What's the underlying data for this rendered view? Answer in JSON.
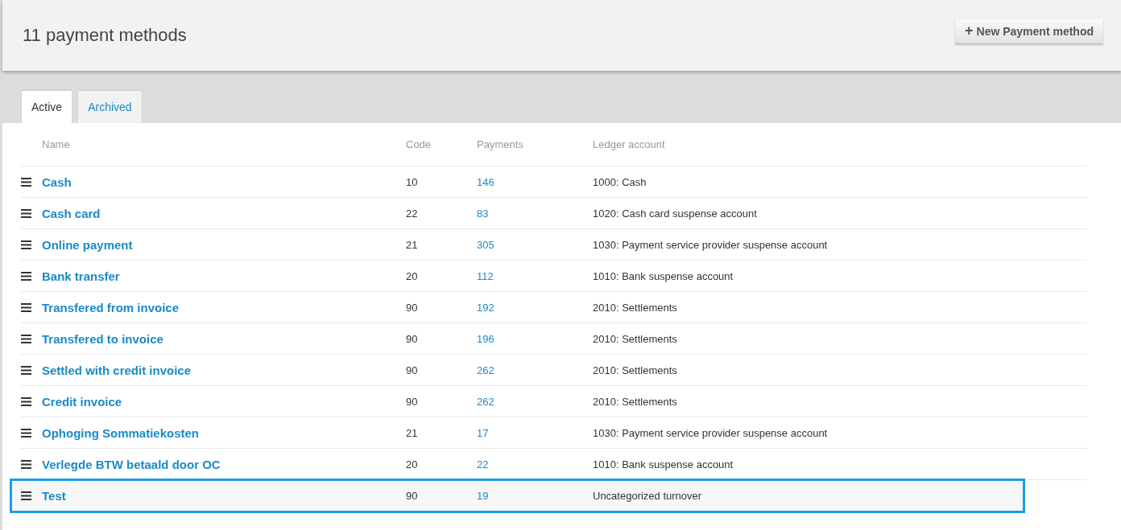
{
  "header": {
    "title": "11 payment methods",
    "new_button": {
      "icon": "+",
      "label": "New Payment method"
    }
  },
  "tabs": [
    {
      "label": "Active",
      "selected": true
    },
    {
      "label": "Archived",
      "selected": false
    }
  ],
  "table": {
    "columns": [
      "Name",
      "Code",
      "Payments",
      "Ledger account"
    ],
    "rows": [
      {
        "name": "Cash",
        "code": "10",
        "payments": "146",
        "ledger": "1000: Cash",
        "selected": false
      },
      {
        "name": "Cash card",
        "code": "22",
        "payments": "83",
        "ledger": "1020: Cash card suspense account",
        "selected": false
      },
      {
        "name": "Online payment",
        "code": "21",
        "payments": "305",
        "ledger": "1030: Payment service provider suspense account",
        "selected": false
      },
      {
        "name": "Bank transfer",
        "code": "20",
        "payments": "112",
        "ledger": "1010: Bank suspense account",
        "selected": false
      },
      {
        "name": "Transfered from invoice",
        "code": "90",
        "payments": "192",
        "ledger": "2010: Settlements",
        "selected": false
      },
      {
        "name": "Transfered to invoice",
        "code": "90",
        "payments": "196",
        "ledger": "2010: Settlements",
        "selected": false
      },
      {
        "name": "Settled with credit invoice",
        "code": "90",
        "payments": "262",
        "ledger": "2010: Settlements",
        "selected": false
      },
      {
        "name": "Credit invoice",
        "code": "90",
        "payments": "262",
        "ledger": "2010: Settlements",
        "selected": false
      },
      {
        "name": "Ophoging Sommatiekosten",
        "code": "21",
        "payments": "17",
        "ledger": "1030: Payment service provider suspense account",
        "selected": false
      },
      {
        "name": "Verlegde BTW betaald door OC",
        "code": "20",
        "payments": "22",
        "ledger": "1010: Bank suspense account",
        "selected": false
      },
      {
        "name": "Test",
        "code": "90",
        "payments": "19",
        "ledger": "Uncategorized turnover",
        "selected": true
      }
    ]
  }
}
